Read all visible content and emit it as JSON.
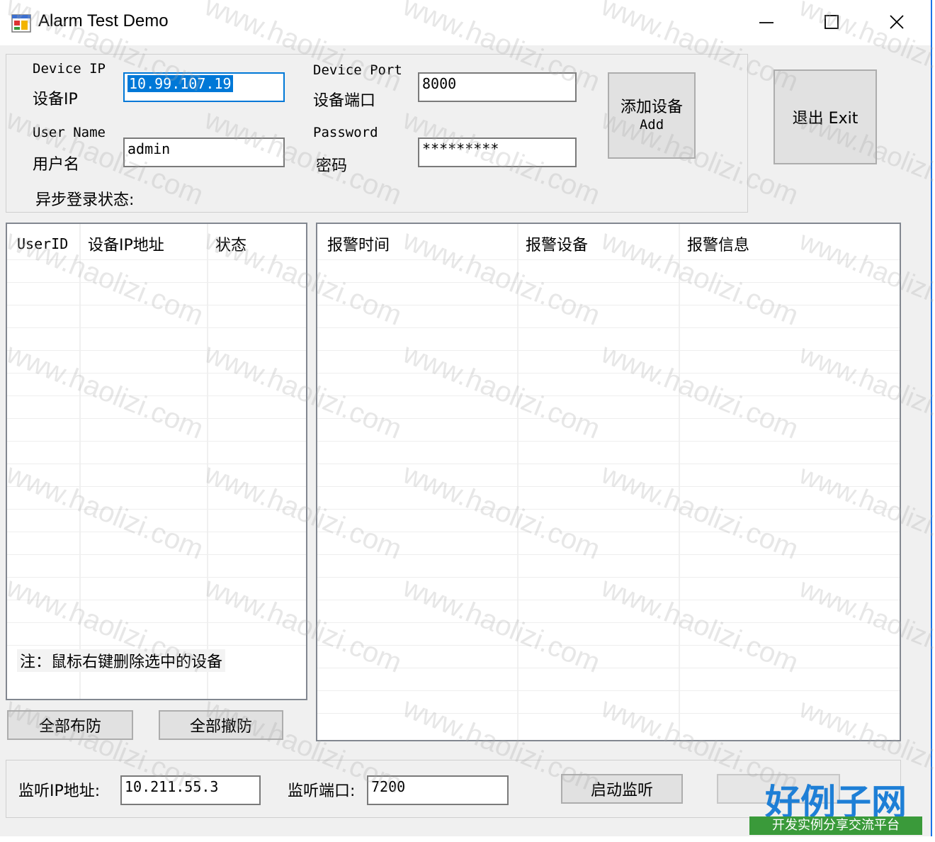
{
  "window": {
    "title": "Alarm Test Demo",
    "min_icon": "minimize-icon",
    "max_icon": "maximize-icon",
    "close_icon": "close-icon"
  },
  "login": {
    "device_ip_en": "Device IP",
    "device_ip_cn": "设备IP",
    "device_ip_value": "10.99.107.19",
    "device_port_en": "Device Port",
    "device_port_cn": "设备端口",
    "device_port_value": "8000",
    "user_name_en": "User Name",
    "user_name_cn": "用户名",
    "user_name_value": "admin",
    "password_en": "Password",
    "password_cn": "密码",
    "password_value": "*********",
    "async_status": "异步登录状态:",
    "add_button_cn": "添加设备",
    "add_button_en": "Add",
    "exit_button": "退出 Exit"
  },
  "device_list": {
    "columns": [
      "UserID",
      "设备IP地址",
      "状态"
    ],
    "note": "注：鼠标右键删除选中的设备"
  },
  "alarm_list": {
    "columns": [
      "报警时间",
      "报警设备",
      "报警信息"
    ]
  },
  "actions": {
    "arm_all": "全部布防",
    "disarm_all": "全部撤防"
  },
  "listen": {
    "ip_label": "监听IP地址:",
    "ip_value": "10.211.55.3",
    "port_label": "监听端口:",
    "port_value": "7200",
    "start_button": "启动监听"
  },
  "watermark": {
    "text": "www.haolizi.com",
    "logo_big": "好例子网",
    "logo_small": "开发实例分享交流平台"
  },
  "colors": {
    "selection": "#0078d7",
    "logo_blue": "#1e7fd6",
    "logo_green": "#3a9a3a"
  }
}
